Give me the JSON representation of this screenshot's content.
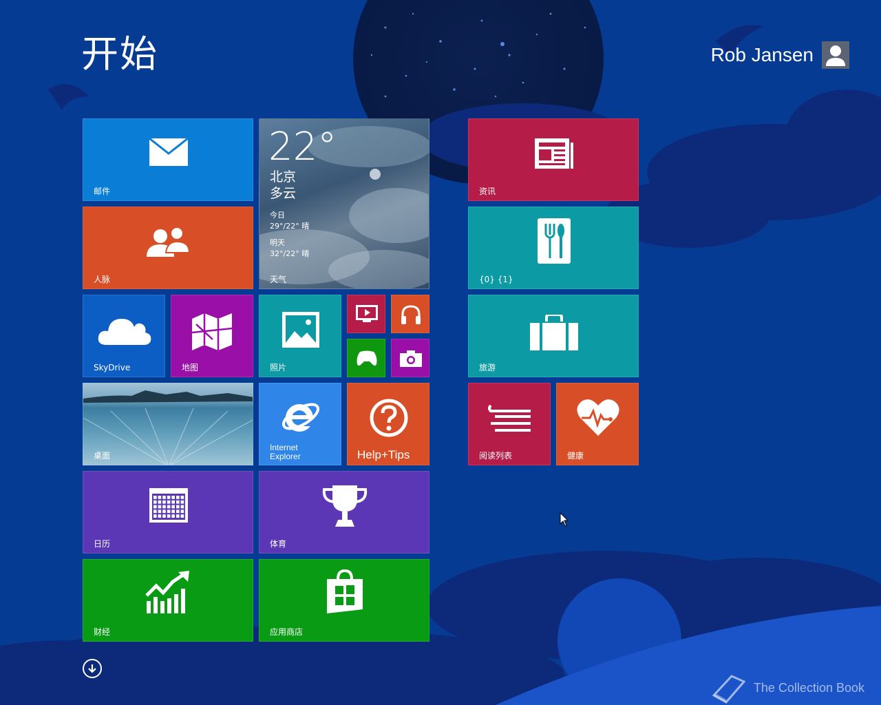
{
  "header": {
    "title": "开始",
    "user_name": "Rob Jansen"
  },
  "tiles": {
    "mail": {
      "label": "邮件",
      "color": "#0a7dd6",
      "icon": "mail-icon"
    },
    "people": {
      "label": "人脉",
      "color": "#d74e27",
      "icon": "people-icon"
    },
    "weather": {
      "label": "天气",
      "temperature": "22°",
      "city": "北京",
      "condition": "多云",
      "today_label": "今日",
      "today_value": "29°/22° 晴",
      "tomorrow_label": "明天",
      "tomorrow_value": "32°/22° 晴"
    },
    "news": {
      "label": "资讯",
      "color": "#b51d48",
      "icon": "news-icon"
    },
    "food": {
      "label": "{0} {1}",
      "color": "#0c9aa5",
      "icon": "fork-spoon-icon"
    },
    "skydrive": {
      "label": "SkyDrive",
      "color": "#0c5dc4",
      "icon": "cloud-icon"
    },
    "maps": {
      "label": "地图",
      "color": "#9a0fa8",
      "icon": "map-icon"
    },
    "photos": {
      "label": "照片",
      "color": "#0c9aa5",
      "icon": "photo-icon"
    },
    "video": {
      "color": "#b51d48",
      "icon": "video-icon"
    },
    "music": {
      "color": "#d74e27",
      "icon": "headphones-icon"
    },
    "games": {
      "color": "#109710",
      "icon": "gamepad-icon"
    },
    "camera": {
      "color": "#9a0fa8",
      "icon": "camera-icon"
    },
    "travel": {
      "label": "旅游",
      "color": "#0c9aa5",
      "icon": "suitcase-icon"
    },
    "desktop": {
      "label": "桌面"
    },
    "ie": {
      "label_line1": "Internet",
      "label_line2": "Explorer",
      "color": "#2f86e8",
      "icon": "ie-icon"
    },
    "help": {
      "label": "Help+Tips",
      "color": "#d74e27",
      "icon": "question-icon"
    },
    "reading_list": {
      "label": "阅读列表",
      "color": "#b51d48",
      "icon": "reading-list-icon"
    },
    "health": {
      "label": "健康",
      "color": "#d74e27",
      "icon": "heart-pulse-icon"
    },
    "calendar": {
      "label": "日历",
      "color": "#5b36b5",
      "icon": "calendar-icon"
    },
    "sports": {
      "label": "体育",
      "color": "#5b36b5",
      "icon": "trophy-icon"
    },
    "finance": {
      "label": "财经",
      "color": "#0a9b14",
      "icon": "chart-up-icon"
    },
    "store": {
      "label": "应用商店",
      "color": "#0a9b14",
      "icon": "store-bag-icon"
    }
  },
  "watermark": {
    "text": "The Collection Book"
  },
  "colors": {
    "background": "#063b93",
    "dark_blue": "#0d2a7a"
  }
}
